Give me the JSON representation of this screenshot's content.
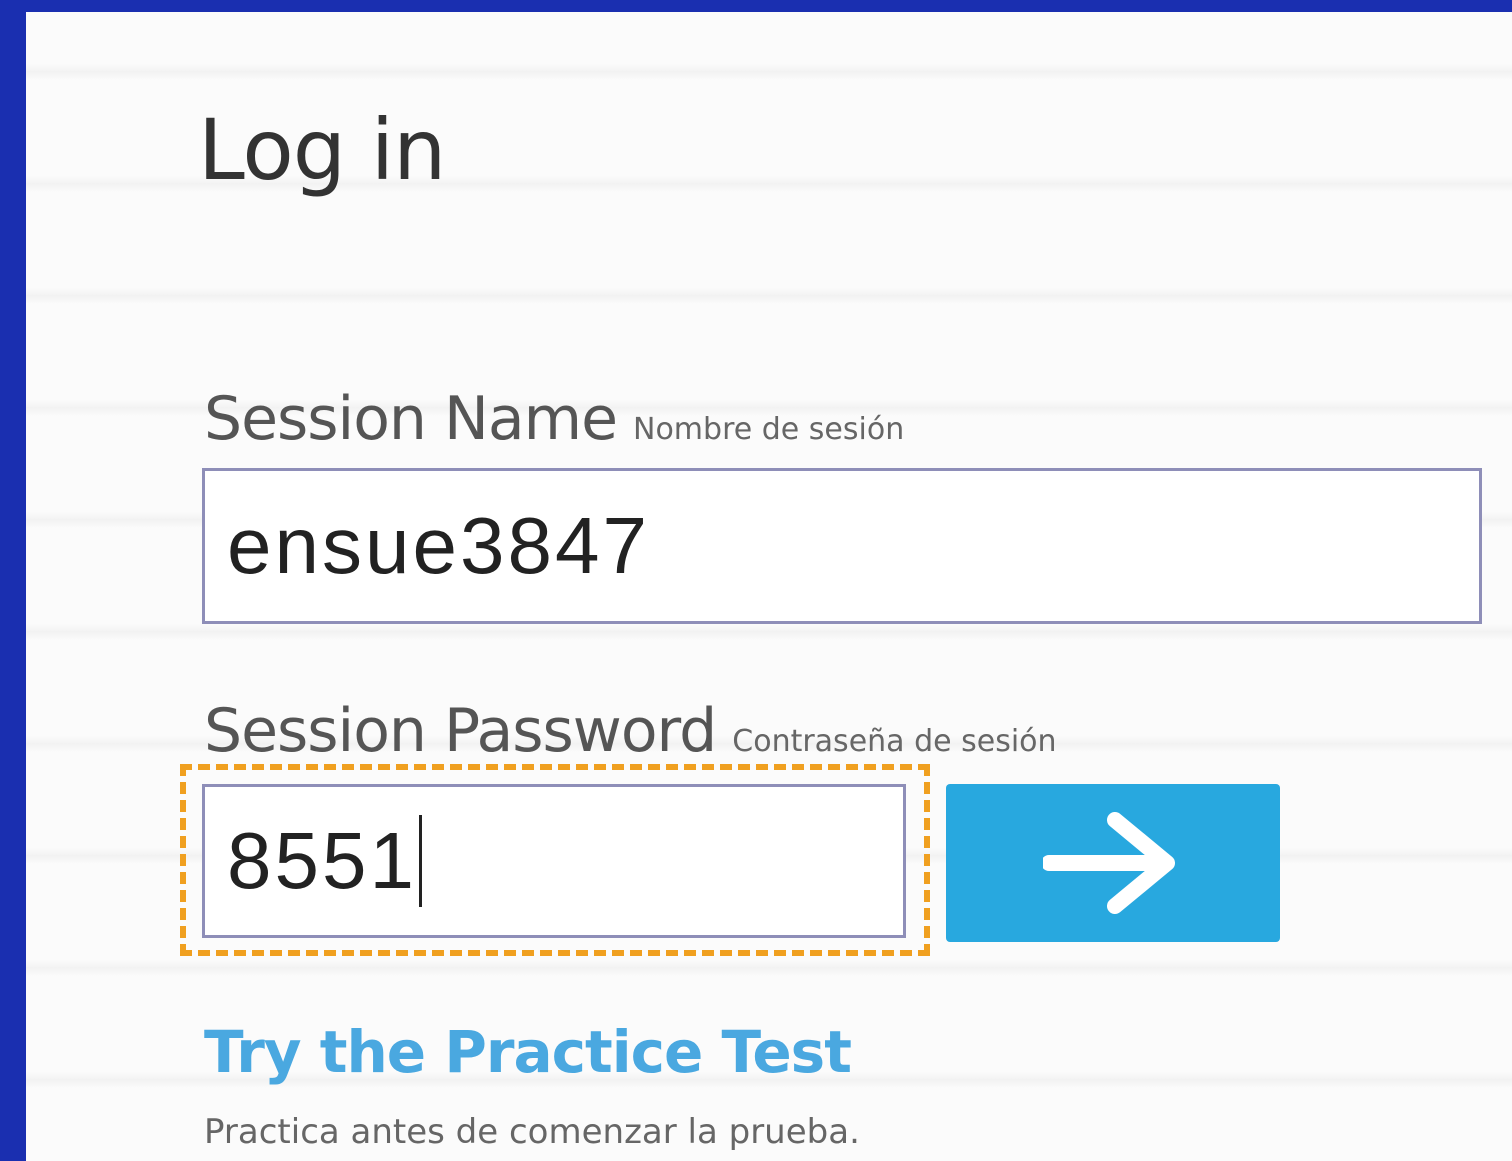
{
  "colors": {
    "frame": "#1a2fb0",
    "accent_button": "#28a8df",
    "link": "#4aa8e0",
    "focus_outline": "#f0a020",
    "input_border": "#8e8eb8"
  },
  "login": {
    "title": "Log in",
    "session_name": {
      "label": "Session Name",
      "label_es": "Nombre de sesión",
      "value": "ensue3847"
    },
    "session_password": {
      "label": "Session Password",
      "label_es": "Contraseña de sesión",
      "value": "8551"
    },
    "submit_icon": "arrow-right-icon",
    "practice": {
      "link_label": "Try the Practice Test",
      "note": "Practica antes de comenzar la prueba."
    }
  }
}
